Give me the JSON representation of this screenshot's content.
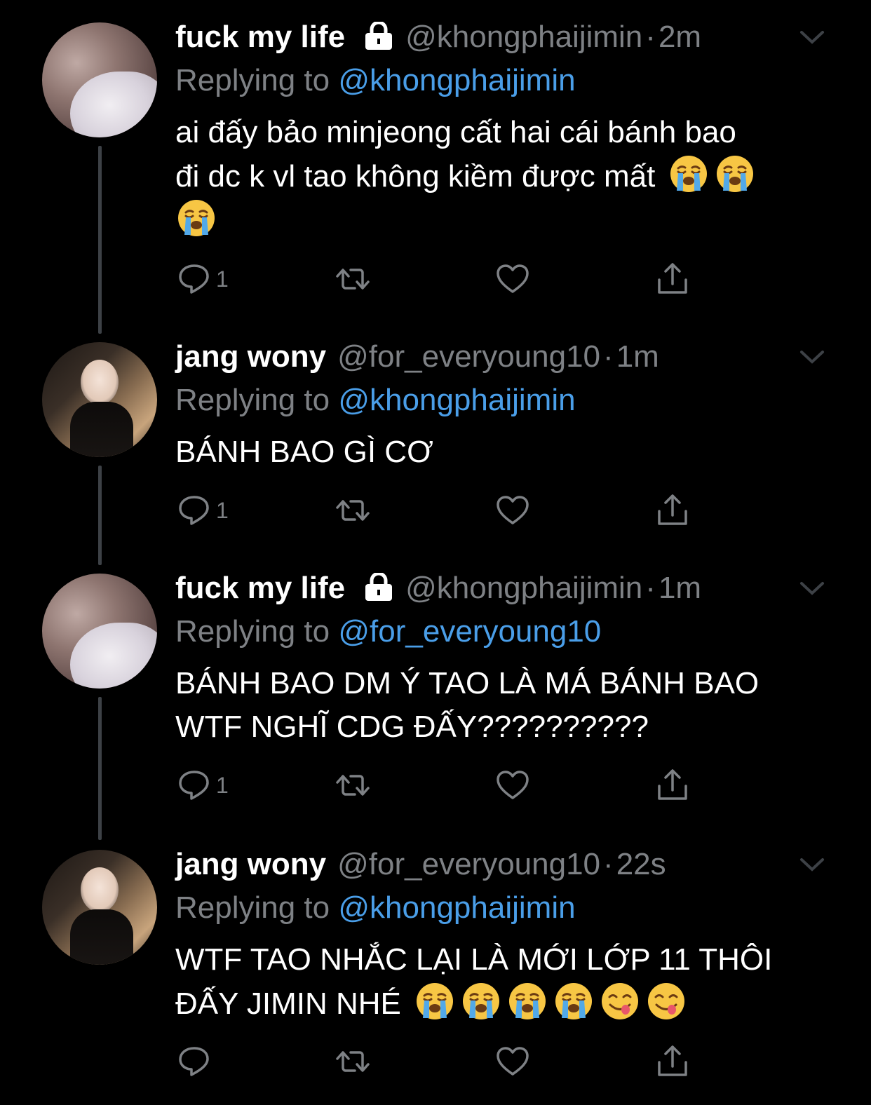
{
  "tweets": [
    {
      "name": "fuck my life",
      "locked": true,
      "handle": "@khongphaijimin",
      "separator": "·",
      "time": "2m",
      "replying_label": "Replying to",
      "replying_to": "@khongphaijimin",
      "body_lines": [
        "ai đấy bảo minjeong cất hai cái bánh bao",
        "đi dc k vl tao không kiềm được mất"
      ],
      "emojis": [
        "loudly-crying-face",
        "loudly-crying-face",
        "loudly-crying-face"
      ],
      "reply_count": "1",
      "avatar": "sleeping-person-avatar"
    },
    {
      "name": "jang wony",
      "locked": false,
      "handle": "@for_everyoung10",
      "separator": "·",
      "time": "1m",
      "replying_label": "Replying to",
      "replying_to": "@khongphaijimin",
      "body_lines": [
        "BÁNH BAO GÌ CƠ"
      ],
      "emojis": [],
      "reply_count": "1",
      "avatar": "woman-in-car-avatar"
    },
    {
      "name": "fuck my life",
      "locked": true,
      "handle": "@khongphaijimin",
      "separator": "·",
      "time": "1m",
      "replying_label": "Replying to",
      "replying_to": "@for_everyoung10",
      "body_lines": [
        "BÁNH BAO DM Ý TAO LÀ MÁ BÁNH BAO",
        "WTF NGHĨ CDG ĐẤY??????????"
      ],
      "emojis": [],
      "reply_count": "1",
      "avatar": "sleeping-person-avatar"
    },
    {
      "name": "jang wony",
      "locked": false,
      "handle": "@for_everyoung10",
      "separator": "·",
      "time": "22s",
      "replying_label": "Replying to",
      "replying_to": "@khongphaijimin",
      "body_lines": [
        "WTF TAO NHẮC LẠI LÀ MỚI LỚP 11 THÔI",
        "ĐẤY JIMIN NHÉ"
      ],
      "emojis": [
        "loudly-crying-face",
        "loudly-crying-face",
        "loudly-crying-face",
        "loudly-crying-face",
        "face-savoring-food",
        "face-savoring-food"
      ],
      "reply_count": "",
      "avatar": "woman-in-car-avatar"
    }
  ],
  "icons": {
    "reply": "reply-icon",
    "retweet": "retweet-icon",
    "like": "heart-icon",
    "share": "share-icon",
    "lock": "lock-icon",
    "menu": "chevron-down-icon"
  },
  "colors": {
    "background": "#000000",
    "text": "#ffffff",
    "secondary": "#7e8185",
    "mention": "#4a9ee8",
    "thread_line": "#3d4146"
  }
}
